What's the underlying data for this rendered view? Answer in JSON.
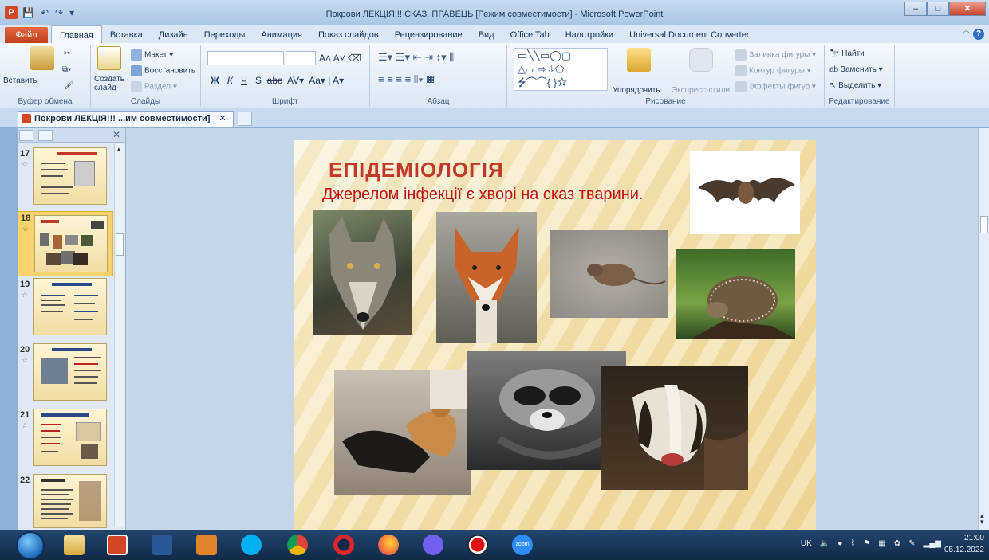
{
  "window": {
    "title": "Покрови ЛЕКЦІЯ!!! СКАЗ. ПРАВЕЦЬ [Режим совместимости] - Microsoft PowerPoint",
    "app_icon": "P",
    "controls": [
      "–",
      "□",
      "✕"
    ]
  },
  "ribbon_tabs": {
    "file": "Файл",
    "tabs": [
      "Главная",
      "Вставка",
      "Дизайн",
      "Переходы",
      "Анимация",
      "Показ слайдов",
      "Рецензирование",
      "Вид",
      "Office Tab",
      "Надстройки",
      "Universal Document Converter"
    ]
  },
  "ribbon": {
    "clipboard": {
      "paste": "Вставить",
      "label": "Буфер обмена"
    },
    "slides": {
      "new_slide": "Создать слайд",
      "layout": "Макет",
      "reset": "Восстановить",
      "section": "Раздел",
      "label": "Слайды"
    },
    "font": {
      "label": "Шрифт",
      "size_up": "A",
      "size_down": "A",
      "bold": "Ж",
      "italic": "К",
      "underline": "Ч",
      "strike": "S",
      "shadow": "abc",
      "spacing": "AV",
      "case": "Aa",
      "color": "A"
    },
    "paragraph": {
      "label": "Абзац"
    },
    "drawing": {
      "arrange": "Упорядочить",
      "quick_styles": "Экспресс-стили",
      "fill": "Заливка фигуры",
      "outline": "Контур фигуры",
      "effects": "Эффекты фигур",
      "label": "Рисование"
    },
    "editing": {
      "find": "Найти",
      "replace": "Заменить",
      "select": "Выделить",
      "label": "Редактирование"
    }
  },
  "document_tab": {
    "label": "Покрови ЛЕКЦІЯ!!! ...им совместимости]",
    "close": "✕"
  },
  "thumbnails": [
    {
      "num": "17",
      "star": "☆"
    },
    {
      "num": "18",
      "star": "☆"
    },
    {
      "num": "19",
      "star": "☆"
    },
    {
      "num": "20",
      "star": "☆"
    },
    {
      "num": "21",
      "star": "☆"
    },
    {
      "num": "22",
      "star": ""
    }
  ],
  "slide": {
    "title": "ЕПІДЕМІОЛОГІЯ",
    "subtitle": "Джерелом інфекції є хворі на сказ тварини.",
    "photos": [
      "bat",
      "wolf",
      "fox",
      "mouse",
      "hedgehog",
      "dog-and-cat",
      "raccoon",
      "badger"
    ]
  },
  "taskbar": {
    "apps": [
      "explorer",
      "powerpoint",
      "word",
      "outlook",
      "skype",
      "chrome",
      "opera",
      "firefox",
      "viber",
      "recorder",
      "zoom"
    ],
    "zoom_label": "zoom",
    "language": "UK",
    "time": "21:00",
    "date": "05.12.2022"
  },
  "colors": {
    "accent": "#d24726",
    "slide_title": "#c0392b",
    "selected_thumb": "#f8d36b"
  }
}
